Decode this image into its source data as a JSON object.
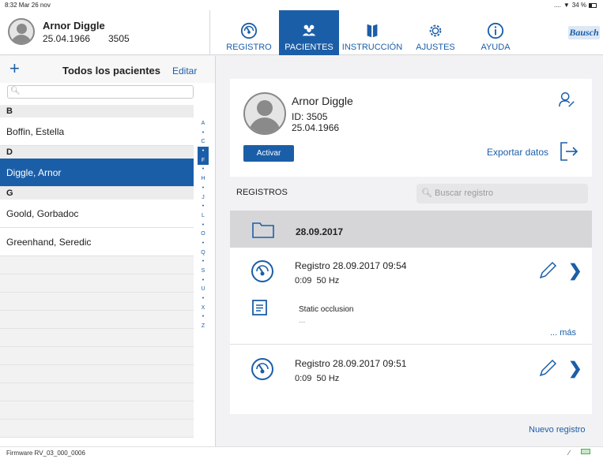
{
  "status_bar": {
    "time": "8:32  Mar 26 nov",
    "signal": "....",
    "battery": "34 %"
  },
  "header": {
    "patient_name": "Arnor Diggle",
    "patient_dob": "25.04.1966",
    "patient_id": "3505",
    "tabs": [
      {
        "label": "REGISTRO",
        "icon": "gauge-icon",
        "active": false
      },
      {
        "label": "PACIENTES",
        "icon": "patients-icon",
        "active": true
      },
      {
        "label": "INSTRUCCIÓN",
        "icon": "book-icon",
        "active": false
      },
      {
        "label": "AJUSTES",
        "icon": "gear-icon",
        "active": false
      },
      {
        "label": "AYUDA",
        "icon": "info-icon",
        "active": false
      }
    ],
    "brand": "Bausch"
  },
  "sidebar": {
    "add_label": "+",
    "title": "Todos los pacientes",
    "edit_label": "Editar",
    "search_placeholder": "",
    "sections": [
      {
        "letter": "B",
        "patients": [
          "Boffin, Estella"
        ]
      },
      {
        "letter": "D",
        "patients": [
          "Diggle, Arnor"
        ]
      },
      {
        "letter": "G",
        "patients": [
          "Goold, Gorbadoc",
          "Greenhand, Seredic"
        ]
      }
    ],
    "selected": "Diggle, Arnor",
    "index": [
      "A",
      "•",
      "C",
      "•",
      "F",
      "•",
      "H",
      "•",
      "J",
      "•",
      "L",
      "•",
      "O",
      "•",
      "Q",
      "•",
      "S",
      "•",
      "U",
      "•",
      "X",
      "•",
      "Z"
    ]
  },
  "patient_card": {
    "name": "Arnor Diggle",
    "id_line": "ID: 3505",
    "dob": "25.04.1966",
    "activate_label": "Activar",
    "export_label": "Exportar datos"
  },
  "records": {
    "header": "REGISTROS",
    "search_placeholder": "Buscar registro",
    "folder_date": "28.09.2017",
    "items": [
      {
        "title": "Registro 28.09.2017 09:54",
        "duration": "0:09",
        "freq": "50 Hz"
      },
      {
        "title": "Registro 28.09.2017 09:51",
        "duration": "0:09",
        "freq": "50 Hz"
      }
    ],
    "note": {
      "text": "Static occlusion",
      "ellipsis": "...",
      "more_label": "... más"
    },
    "new_label": "Nuevo registro"
  },
  "footer": {
    "firmware": "Firmware RV_03_000_0006"
  },
  "colors": {
    "accent": "#1b5ea8",
    "selected_row": "#1b5ea8",
    "folder_bg": "#d6d6d8"
  }
}
